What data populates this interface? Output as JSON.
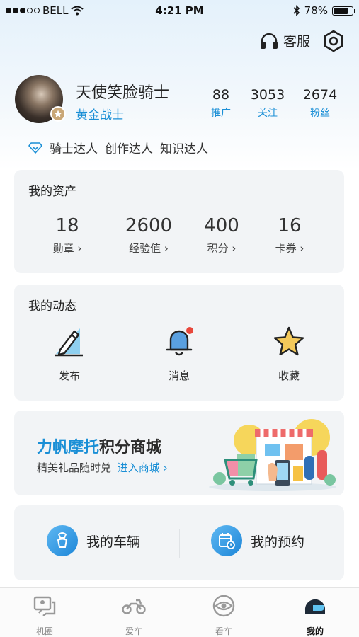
{
  "status_bar": {
    "carrier": "BELL",
    "time": "4:21 PM",
    "battery": "78%",
    "battery_level": 0.78
  },
  "top_actions": {
    "service_label": "客服",
    "service_icon": "headset-icon",
    "settings_icon": "gear-icon"
  },
  "profile": {
    "name": "天使笑脸骑士",
    "rank": "黄金战士",
    "stats": [
      {
        "value": "88",
        "label": "推广"
      },
      {
        "value": "3053",
        "label": "关注"
      },
      {
        "value": "2674",
        "label": "粉丝"
      }
    ],
    "tags": [
      "骑士达人",
      "创作达人",
      "知识达人"
    ]
  },
  "assets": {
    "title": "我的资产",
    "items": [
      {
        "value": "18",
        "label": "勋章"
      },
      {
        "value": "2600",
        "label": "经验值"
      },
      {
        "value": "400",
        "label": "积分"
      },
      {
        "value": "16",
        "label": "卡券"
      }
    ]
  },
  "activity": {
    "title": "我的动态",
    "items": [
      {
        "label": "发布",
        "icon": "pencil-icon"
      },
      {
        "label": "消息",
        "icon": "bell-icon"
      },
      {
        "label": "收藏",
        "icon": "star-icon"
      }
    ]
  },
  "mall": {
    "title_blue": "力帆摩托",
    "title_dark": "积分商城",
    "subtitle": "精美礼品随时兑",
    "link": "进入商城"
  },
  "garage": {
    "vehicles": "我的车辆",
    "appointments": "我的预约"
  },
  "tabbar": {
    "items": [
      {
        "label": "机圈",
        "icon": "chat-icon"
      },
      {
        "label": "爱车",
        "icon": "motorcycle-icon"
      },
      {
        "label": "看车",
        "icon": "eye-icon"
      },
      {
        "label": "我的",
        "icon": "helmet-icon"
      }
    ],
    "active_index": 3
  },
  "colors": {
    "accent": "#1a8fd6",
    "card_bg": "#f2f4f6",
    "notification": "#e8473b",
    "star": "#f4c95a"
  }
}
